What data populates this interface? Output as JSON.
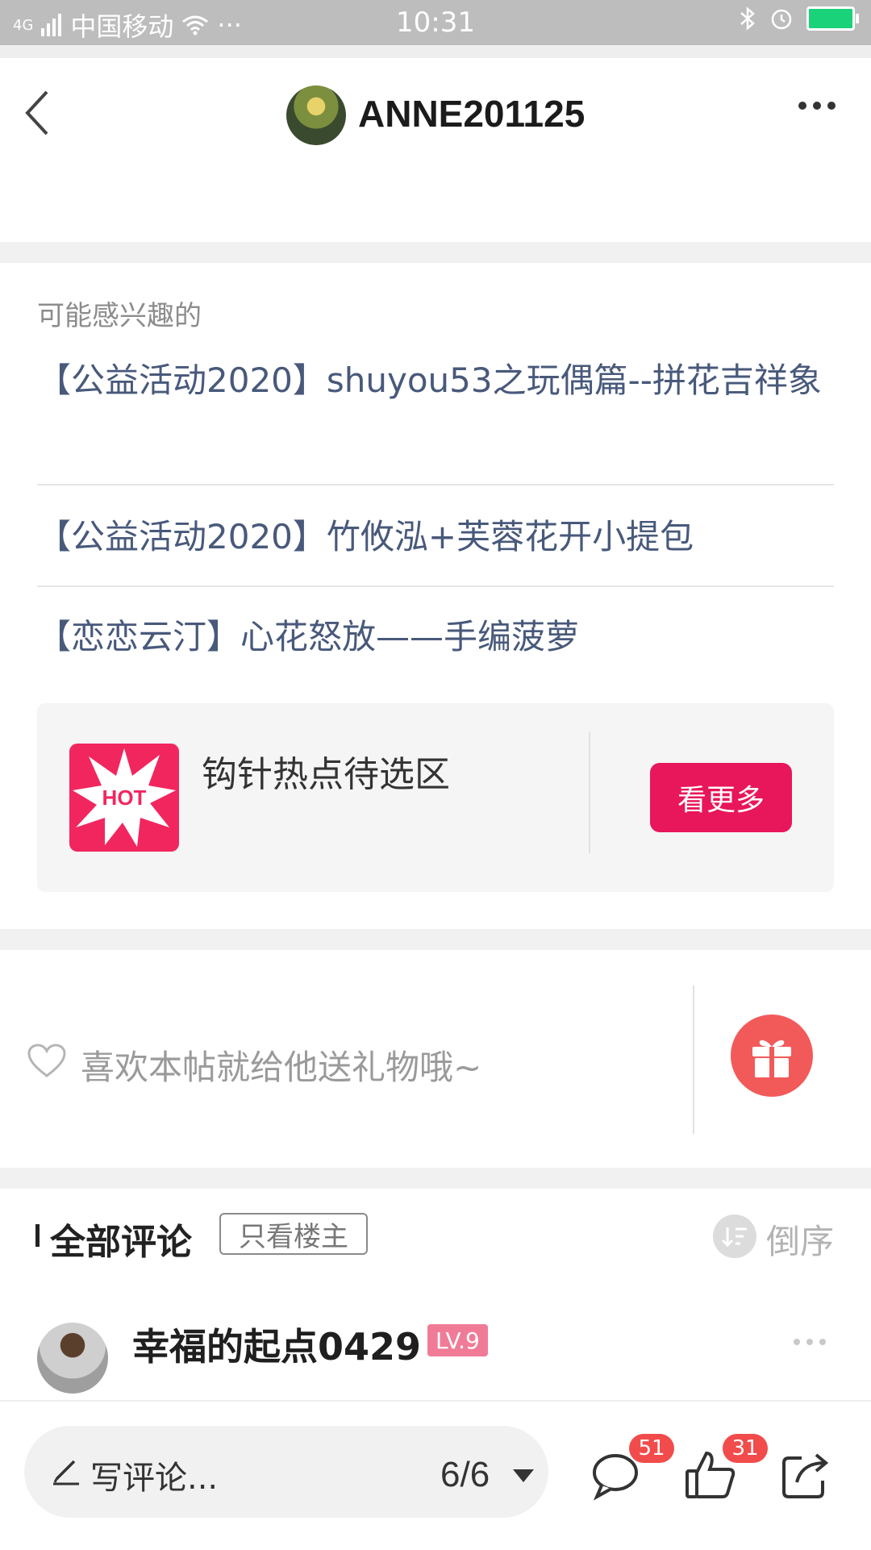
{
  "status_bar": {
    "network": "4G",
    "carrier": "中国移动",
    "more": "···",
    "time": "10:31"
  },
  "header": {
    "author": "ANNE201125"
  },
  "interest": {
    "title": "可能感兴趣的",
    "links": [
      "【公益活动2020】shuyou53之玩偶篇--拼花吉祥象",
      "【公益活动2020】竹攸泓+芙蓉花开小提包",
      "【恋恋云汀】心花怒放——手编菠萝"
    ],
    "hot": {
      "icon_text": "HOT",
      "title": "钩针热点待选区",
      "button": "看更多"
    }
  },
  "gift": {
    "text": "喜欢本帖就给他送礼物哦~"
  },
  "comments": {
    "title": "全部评论",
    "filter": "只看楼主",
    "sort": "倒序",
    "first": {
      "name": "幸福的起点0429",
      "level": "LV.9"
    }
  },
  "bottom_bar": {
    "write_placeholder": "写评论...",
    "pager": "6/6",
    "comment_count": "51",
    "like_count": "31"
  },
  "colors": {
    "accent": "#e8165a",
    "link": "#48597b",
    "badge": "#f24b4b"
  }
}
